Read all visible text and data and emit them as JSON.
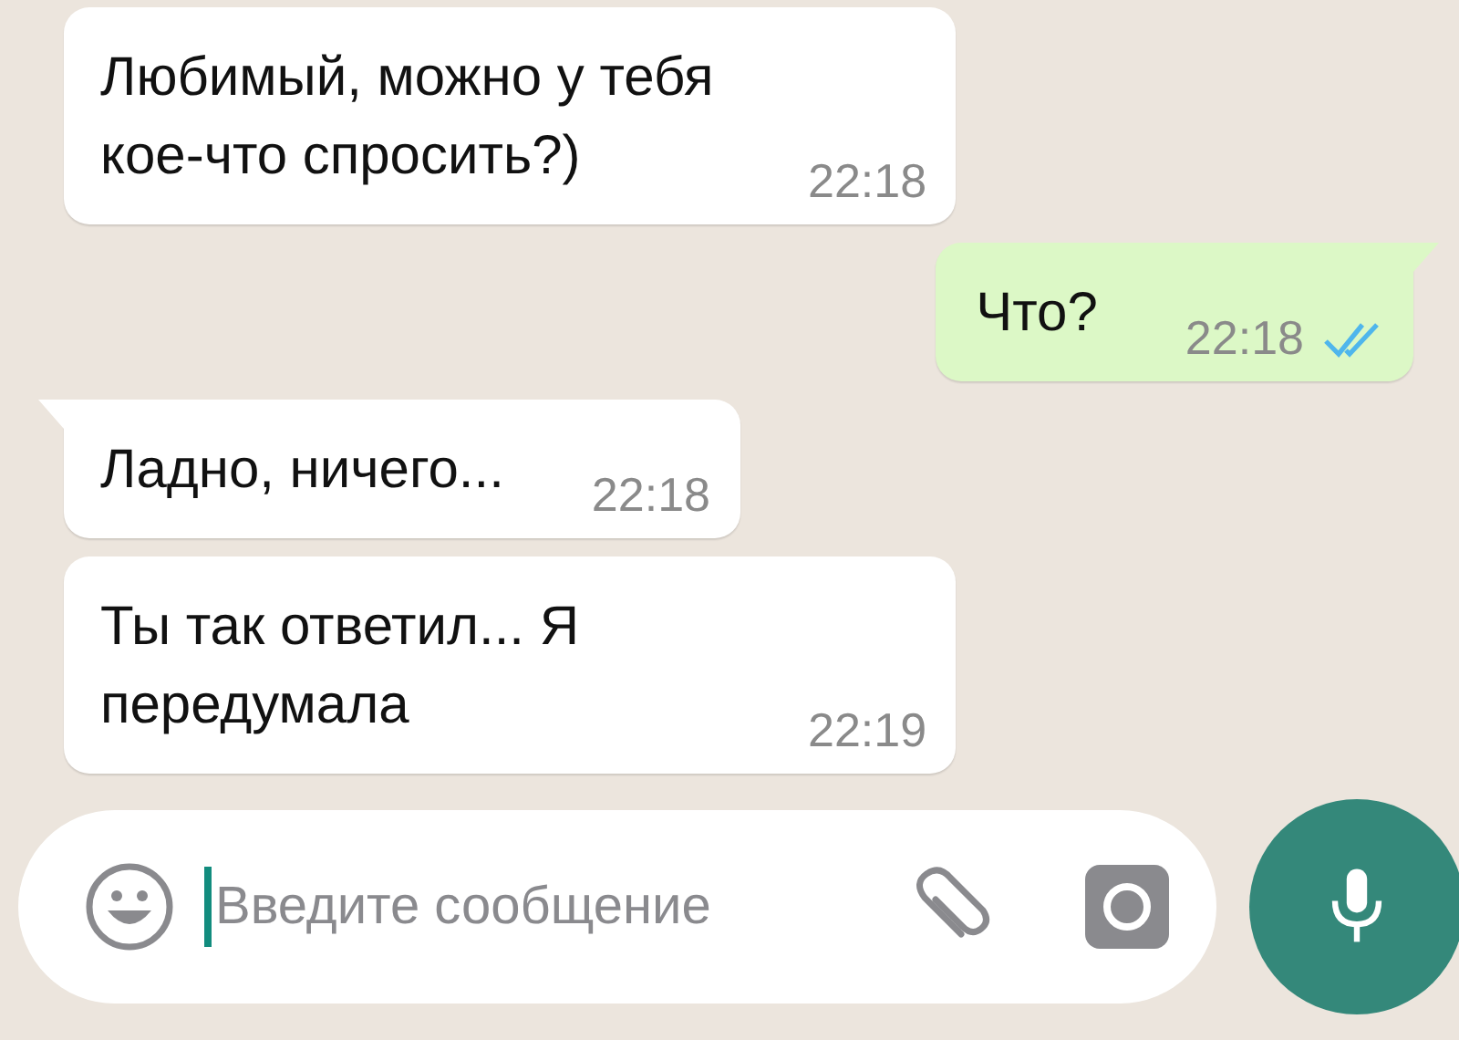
{
  "messages": [
    {
      "kind": "incoming",
      "tail": false,
      "text": "Любимый, можно у тебя кое-что спросить?)",
      "time": "22:18"
    },
    {
      "kind": "outgoing",
      "tail": true,
      "text": "Что?",
      "time": "22:18",
      "read": true
    },
    {
      "kind": "incoming",
      "tail": true,
      "text": "Ладно, ничего...",
      "time": "22:18"
    },
    {
      "kind": "incoming",
      "tail": false,
      "text": "Ты так ответил... Я передумала",
      "time": "22:19"
    }
  ],
  "composer": {
    "placeholder": "Введите сообщение"
  }
}
